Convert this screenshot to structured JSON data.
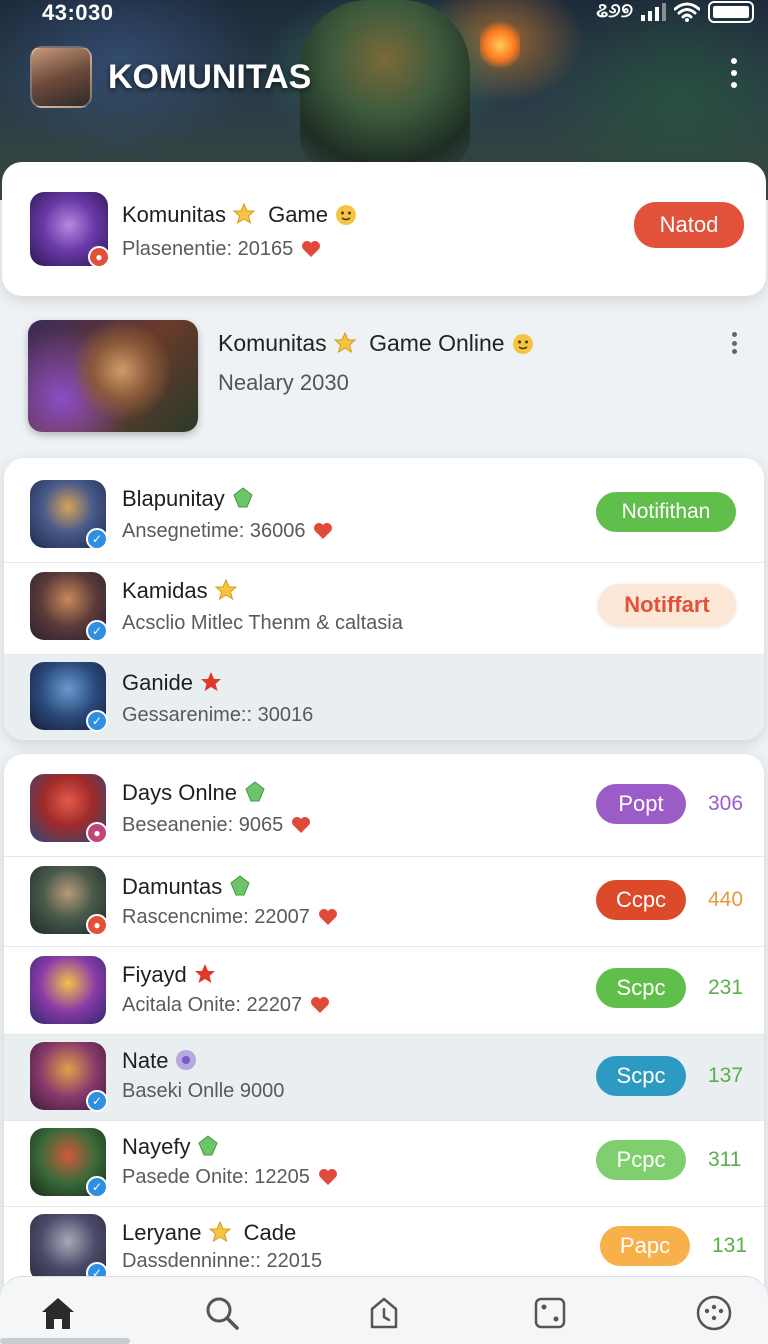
{
  "status_bar": {
    "time": "43:030",
    "network_label": "ଌ୬୭",
    "icons": [
      "signal-icon",
      "wifi-icon",
      "battery-icon"
    ]
  },
  "header": {
    "title": "KOMUNITAS",
    "menu_icon": "more-vertical-icon"
  },
  "top_card": {
    "title": "Komunitas",
    "title_emoji": "star",
    "title_suffix": "Game",
    "title_emoji_2": "smiley",
    "subtitle": "Plasenentie: 20165",
    "button_label": "Natod",
    "button_color": "#e2513a"
  },
  "featured": {
    "title": "Komunitas",
    "title_emoji": "star",
    "title_suffix": "Game Online",
    "title_emoji_2": "smiley",
    "subtitle": "Nealary 2030"
  },
  "list_a": [
    {
      "title": "Blapunitay",
      "emoji": "green-gem",
      "subtitle": "Ansegnetime: 36006",
      "heart": true,
      "badge": "verified",
      "button_label": "Notifithan",
      "button_color": "#5fbf4a",
      "button_text_color": "#ffffff",
      "highlight": false
    },
    {
      "title": "Kamidas",
      "emoji": "star",
      "subtitle": "Acsclio Mitlec Thenm & caltasia",
      "heart": false,
      "badge": "verified",
      "button_label": "Notiffart",
      "button_color": "#fde7d6",
      "button_text_color": "#e2513a",
      "highlight": false
    },
    {
      "title": "Ganide",
      "emoji": "red-star",
      "subtitle": "Gessarenime:: 30016",
      "heart": false,
      "badge": "verified",
      "button_label": "",
      "highlight": true
    }
  ],
  "list_b": [
    {
      "title": "Days Onlne",
      "emoji": "green-gem",
      "subtitle": "Beseanenie: 9065",
      "heart": true,
      "badge": "purple",
      "button_label": "Popt",
      "button_color": "#9b5cc7",
      "count": "306",
      "count_color": "#9b5cc7",
      "highlight": false
    },
    {
      "title": "Damuntas",
      "emoji": "green-gem",
      "subtitle": "Rascencnime: 22007",
      "heart": true,
      "badge": "red",
      "button_label": "Ccpc",
      "button_color": "#dc4a2a",
      "count": "440",
      "count_color": "#e59a3a",
      "highlight": false
    },
    {
      "title": "Fiyayd",
      "emoji": "red-star",
      "subtitle": "Acitala Onite: 22207",
      "heart": true,
      "badge": "none",
      "button_label": "Scpc",
      "button_color": "#5fbf4a",
      "count": "231",
      "count_color": "#5aaf4a",
      "highlight": false
    },
    {
      "title": "Nate",
      "emoji": "purple-circle",
      "subtitle": "Baseki Onlle 9000",
      "heart": false,
      "badge": "verified",
      "button_label": "Scpc",
      "button_color": "#2d9ac2",
      "count": "137",
      "count_color": "#5aaf4a",
      "highlight": true
    },
    {
      "title": "Nayefy",
      "emoji": "green-gem",
      "subtitle": "Pasede Onite: 12205",
      "heart": true,
      "badge": "verified",
      "button_label": "Pcpc",
      "button_color": "#7fcf6f",
      "count": "311",
      "count_color": "#5aaf4a",
      "highlight": false
    },
    {
      "title": "Leryane",
      "emoji": "star",
      "title_suffix": "Cade",
      "subtitle": "Dassdenninne:: 22015",
      "heart": false,
      "badge": "verified",
      "button_label": "Papc",
      "button_color": "#f7b04a",
      "count": "131",
      "count_color": "#5aaf4a",
      "highlight": false
    }
  ],
  "bottom_nav": [
    "home-icon",
    "search-icon",
    "clock-icon",
    "dice-icon",
    "more-circle-icon"
  ]
}
